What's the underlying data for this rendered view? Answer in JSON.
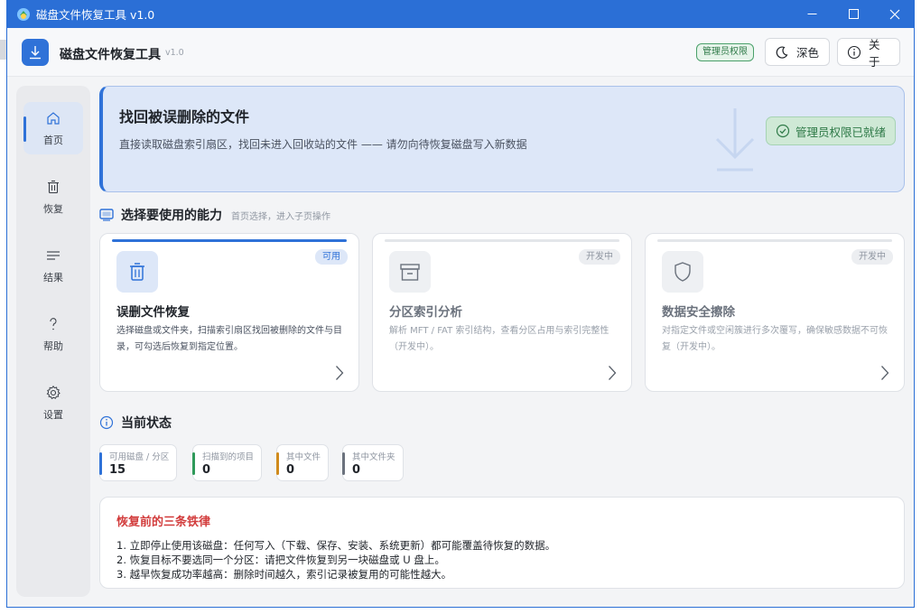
{
  "window": {
    "title": "磁盘文件恢复工具 v1.0"
  },
  "header": {
    "app_name": "磁盘文件恢复工具",
    "version": "v1.0",
    "admin_badge": "管理员权限",
    "theme_button": "深色",
    "about_button": "关于"
  },
  "sidebar": {
    "items": [
      {
        "label": "首页",
        "icon": "home-icon",
        "active": true
      },
      {
        "label": "恢复",
        "icon": "trash-icon"
      },
      {
        "label": "结果",
        "icon": "list-icon"
      },
      {
        "label": "帮助",
        "icon": "help-icon"
      },
      {
        "label": "设置",
        "icon": "gear-icon"
      }
    ]
  },
  "hero": {
    "title": "找回被误删除的文件",
    "subtitle": "直接读取磁盘索引扇区，找回未进入回收站的文件 —— 请勿向待恢复磁盘写入新数据",
    "status": "管理员权限已就绪"
  },
  "capabilities": {
    "title": "选择要使用的能力",
    "hint": "首页选择，进入子页操作",
    "cards": [
      {
        "title": "误删文件恢复",
        "tag": "可用",
        "desc": "选择磁盘或文件夹，扫描索引扇区找回被删除的文件与目录，可勾选后恢复到指定位置。"
      },
      {
        "title": "分区索引分析",
        "tag": "开发中",
        "desc": "解析 MFT / FAT 索引结构，查看分区占用与索引完整性（开发中）。"
      },
      {
        "title": "数据安全擦除",
        "tag": "开发中",
        "desc": "对指定文件或空闲簇进行多次覆写，确保敏感数据不可恢复（开发中）。"
      }
    ]
  },
  "status": {
    "title": "当前状态",
    "stats": [
      {
        "label": "可用磁盘 / 分区",
        "value": "15",
        "color": "#2f72d8"
      },
      {
        "label": "扫描到的项目",
        "value": "0",
        "color": "#2f9a5a"
      },
      {
        "label": "其中文件",
        "value": "0",
        "color": "#d08a1c"
      },
      {
        "label": "其中文件夹",
        "value": "0",
        "color": "#6b727d"
      }
    ]
  },
  "rules": {
    "title": "恢复前的三条铁律",
    "lines": [
      "1. 立即停止使用该磁盘：任何写入（下载、保存、安装、系统更新）都可能覆盖待恢复的数据。",
      "2. 恢复目标不要选同一个分区：请把文件恢复到另一块磁盘或 U 盘上。",
      "3. 越早恢复成功率越高：删除时间越久，索引记录被复用的可能性越大。"
    ]
  },
  "colors": {
    "accent": "#2f72d8",
    "success": "#2f7a48",
    "danger": "#d23c3c"
  }
}
